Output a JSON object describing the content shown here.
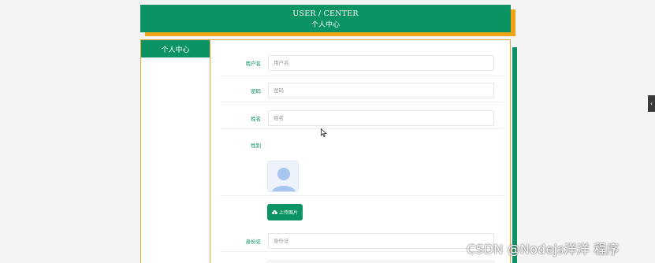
{
  "header": {
    "title_en": "USER / CENTER",
    "title_zh": "个人中心"
  },
  "sidebar": {
    "items": [
      {
        "label": "个人中心"
      }
    ]
  },
  "form": {
    "username": {
      "label": "用户名",
      "placeholder": "用户名"
    },
    "password": {
      "label": "密码",
      "placeholder": "密码"
    },
    "name": {
      "label": "姓名",
      "placeholder": "姓名"
    },
    "gender": {
      "label": "性别"
    },
    "upload": {
      "label": "上传图片"
    },
    "id_card": {
      "label": "身份证",
      "placeholder": "身份证"
    }
  },
  "side_toggle": {
    "glyph": "‹"
  },
  "watermark": "CSDN @Nodejs洋洋  程序",
  "colors": {
    "primary": "#0b9363",
    "accent": "#f2a417",
    "border": "#e8a63a"
  },
  "icons": {
    "upload": "cloud-upload-icon",
    "avatar": "user-avatar-icon"
  }
}
